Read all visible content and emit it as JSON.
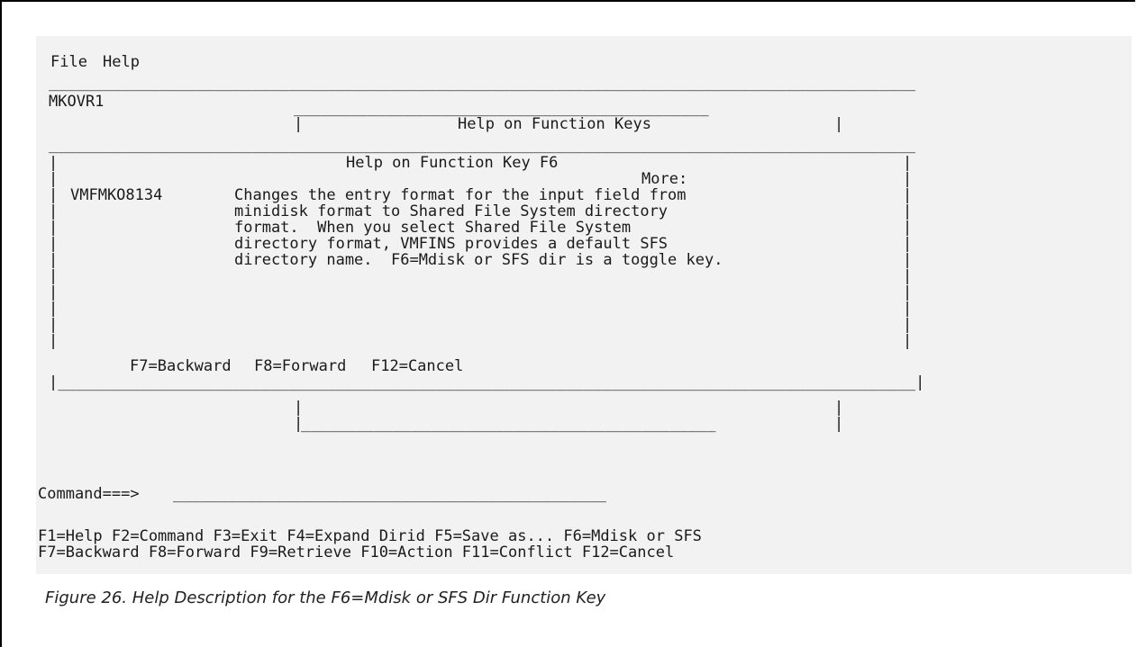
{
  "menu": {
    "file": "File",
    "help": "Help"
  },
  "screen_id": "MKOVR1",
  "outer_window": {
    "title": "Help on Function Keys"
  },
  "help_window": {
    "title": "Help on Function Key F6",
    "more_label": "More:",
    "message_id": "VMFMKO8134",
    "text_lines": [
      "Changes the entry format for the input field from",
      "minidisk format to Shared File System directory",
      "format.  When you select Shared File System",
      "directory format, VMFINS provides a default SFS",
      "directory name.  F6=Mdisk or SFS dir is a toggle key."
    ],
    "keys": {
      "f7": "F7=Backward",
      "f8": "F8=Forward",
      "f12": "F12=Cancel"
    }
  },
  "command": {
    "prompt": "Command===>",
    "field": "_______________________________________________"
  },
  "function_keys": {
    "line1": "F1=Help F2=Command F3=Exit F4=Expand Dirid F5=Save as... F6=Mdisk or SFS",
    "line2": "F7=Backward F8=Forward F9=Retrieve F10=Action F11=Conflict F12=Cancel"
  },
  "caption": "Figure 26. Help Description for the F6=Mdisk or SFS Dir Function Key"
}
